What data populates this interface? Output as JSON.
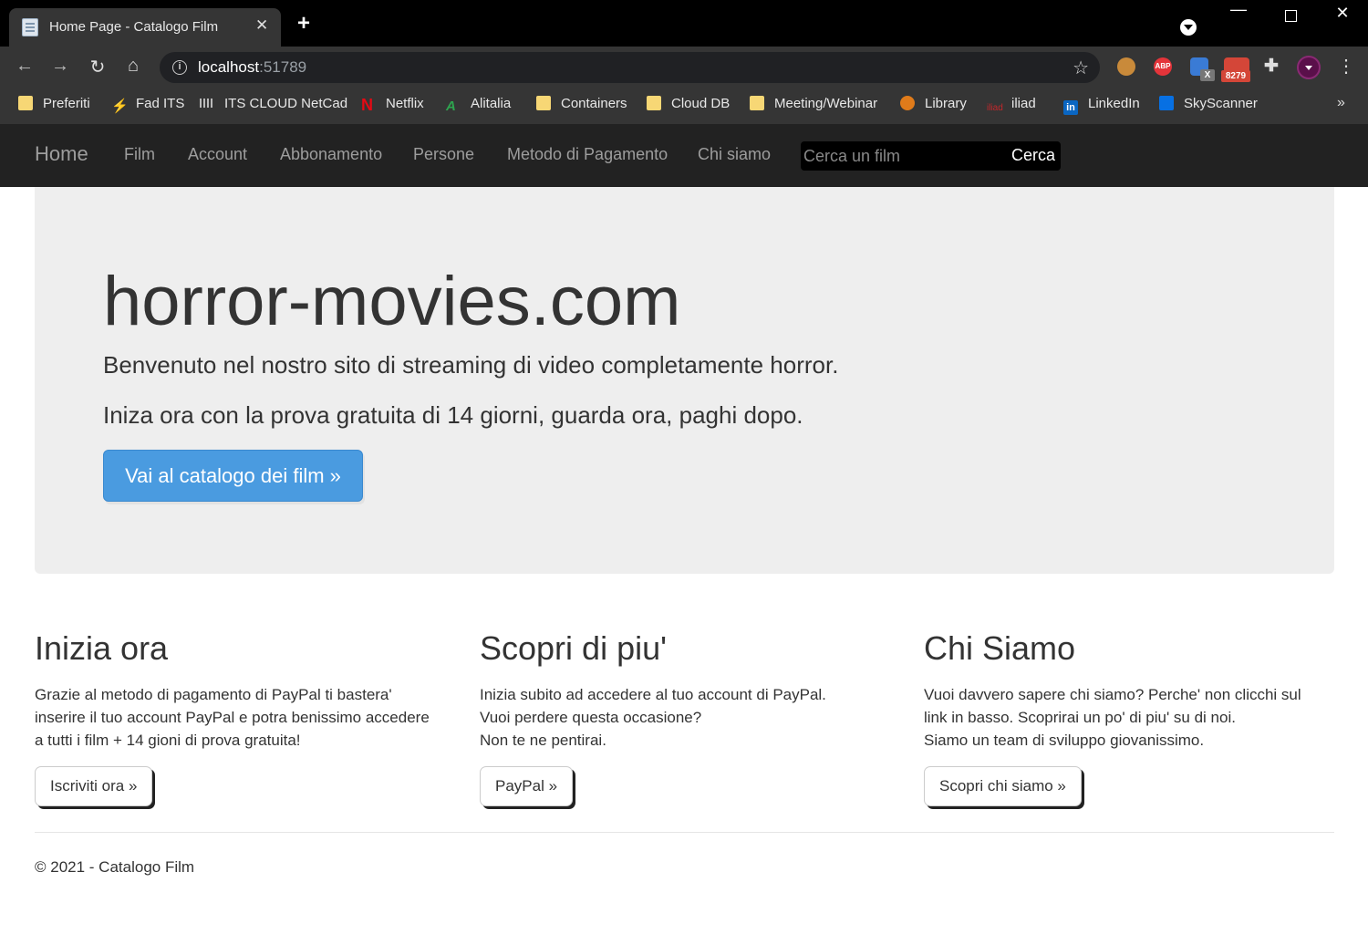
{
  "browser": {
    "tab_title": "Home Page - Catalogo Film",
    "tab_close": "✕",
    "new_tab": "+",
    "url_host": "localhost",
    "url_port": ":51789",
    "extensions": {
      "abp": "ABP",
      "x_badge": "X",
      "mail_badge": "8279",
      "linkedin_glyph": "in"
    },
    "bookmarks": [
      {
        "label": "Preferiti",
        "icon": "folder-icon"
      },
      {
        "label": "Fad ITS",
        "icon": "bolt-icon"
      },
      {
        "label": "ITS CLOUD NetCad",
        "icon": "cisco-icon"
      },
      {
        "label": "Netflix",
        "icon": "netflix-icon"
      },
      {
        "label": "Alitalia",
        "icon": "alitalia-icon"
      },
      {
        "label": "Containers",
        "icon": "folder-icon"
      },
      {
        "label": "Cloud DB",
        "icon": "folder-icon"
      },
      {
        "label": "Meeting/Webinar",
        "icon": "folder-icon"
      },
      {
        "label": "Library",
        "icon": "library-icon"
      },
      {
        "label": "iliad",
        "icon": "iliad-icon"
      },
      {
        "label": "LinkedIn",
        "icon": "linkedin-icon"
      },
      {
        "label": "SkyScanner",
        "icon": "skyscanner-icon"
      }
    ],
    "bookmarks_more": "»"
  },
  "navbar": {
    "brand": "Home",
    "links": [
      "Film",
      "Account",
      "Abbonamento",
      "Persone",
      "Metodo di Pagamento",
      "Chi siamo"
    ],
    "search_placeholder": "Cerca un film",
    "search_button": "Cerca"
  },
  "jumbotron": {
    "title": "horror-movies.com",
    "lead1": "Benvenuto nel nostro sito di streaming di video completamente horror.",
    "lead2": "Iniza ora con la prova gratuita di 14 giorni, guarda ora, paghi dopo.",
    "button": "Vai al catalogo dei film »"
  },
  "columns": [
    {
      "heading": "Inizia ora",
      "text": "Grazie al metodo di pagamento di PayPal ti bastera'\ninserire il tuo account PayPal e potra benissimo accedere\na tutti i film + 14 gioni di prova gratuita!",
      "button": "Iscriviti ora »"
    },
    {
      "heading": "Scopri di piu'",
      "text": "Inizia subito ad accedere al tuo account di PayPal.\nVuoi perdere questa occasione?\nNon te ne pentirai.",
      "button": "PayPal »"
    },
    {
      "heading": "Chi Siamo",
      "text": "Vuoi davvero sapere chi siamo? Perche' non clicchi sul\nlink in basso. Scoprirai un po' di piu' su di noi.\nSiamo un team di sviluppo giovanissimo.",
      "button": "Scopri chi siamo »"
    }
  ],
  "footer": "© 2021 - Catalogo Film"
}
